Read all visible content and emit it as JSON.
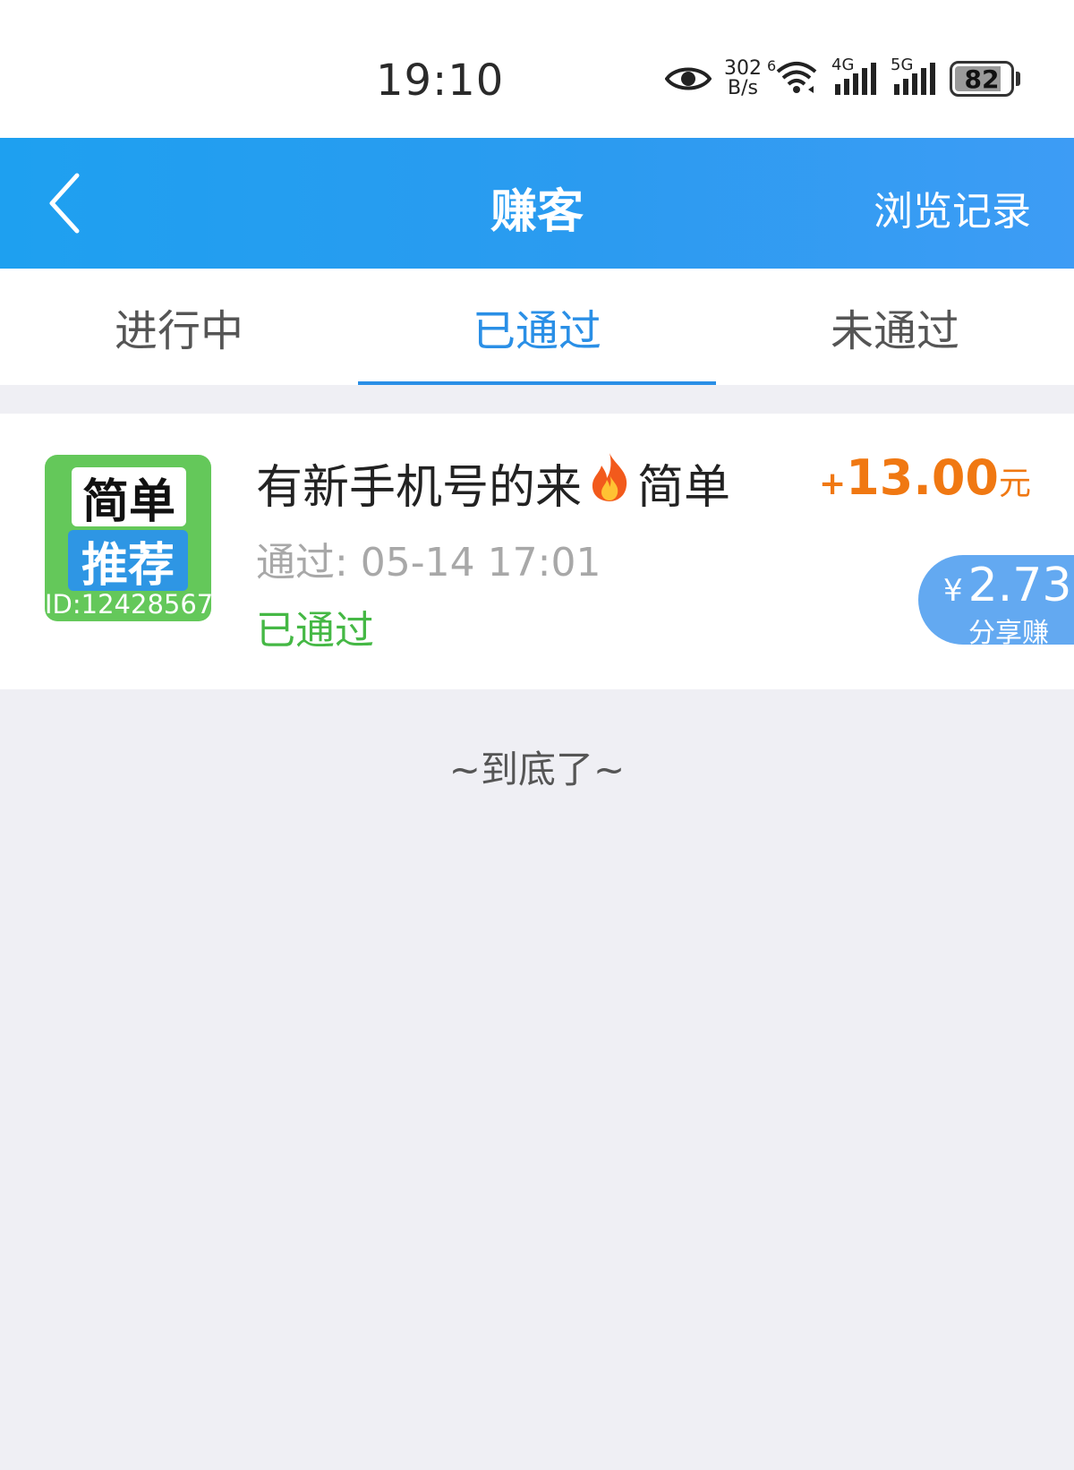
{
  "status_bar": {
    "time": "19:10",
    "net_speed_value": "302",
    "net_speed_unit": "B/s",
    "wifi_tag": "6",
    "sig1_tag": "4G",
    "sig2_tag": "5G",
    "battery_level": "82"
  },
  "header": {
    "title": "赚客",
    "right_link": "浏览记录"
  },
  "tabs": [
    {
      "label": "进行中",
      "active": false
    },
    {
      "label": "已通过",
      "active": true
    },
    {
      "label": "未通过",
      "active": false
    }
  ],
  "task": {
    "thumb_top": "简单",
    "thumb_mid": "推荐",
    "thumb_id": "ID:12428567",
    "title_prefix": "有新手机号的来",
    "title_suffix": "简单",
    "time": "通过:  05-14 17:01",
    "status": "已通过",
    "reward_plus": "+",
    "reward_amount": "13.00",
    "reward_unit": "元",
    "share_yen": "¥",
    "share_value": "2.73",
    "share_label": "分享赚"
  },
  "footer": {
    "end_text": "~到底了~"
  },
  "colors": {
    "header_blue": "#2b9bf0",
    "active_tab": "#2a8fe6",
    "reward_orange": "#f07812",
    "status_green": "#45b845",
    "share_blue": "#63a9f1"
  }
}
